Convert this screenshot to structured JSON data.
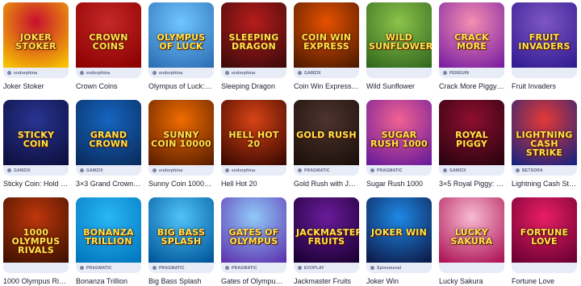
{
  "games": [
    {
      "caption": "Joker Stoker",
      "art": "JOKER STOKER",
      "bg": [
        "#c8102e",
        "#f7c400"
      ],
      "provider": "endorphina"
    },
    {
      "caption": "Crown Coins",
      "art": "CROWN COINS",
      "bg": [
        "#c62828",
        "#8b0000"
      ],
      "provider": "endorphina"
    },
    {
      "caption": "Olympus of Luck: H...",
      "art": "OLYMPUS OF LUCK",
      "bg": [
        "#6ec6ff",
        "#2e6fb5"
      ],
      "provider": "endorphina"
    },
    {
      "caption": "Sleeping Dragon",
      "art": "SLEEPING DRAGON",
      "bg": [
        "#b71c1c",
        "#3e0a0a"
      ],
      "provider": "endorphina"
    },
    {
      "caption": "Coin Win Express: H...",
      "art": "COIN WIN EXPRESS",
      "bg": [
        "#e65100",
        "#4e1a00"
      ],
      "provider": "GAMZIX"
    },
    {
      "caption": "Wild Sunflower",
      "art": "WILD SUNFLOWER",
      "bg": [
        "#8bc34a",
        "#33691e"
      ],
      "provider": ""
    },
    {
      "caption": "Crack More Piggy B...",
      "art": "CRACK MORE",
      "bg": [
        "#f48fb1",
        "#7b1fa2"
      ],
      "provider": "PENGUIN"
    },
    {
      "caption": "Fruit Invaders",
      "art": "FRUIT INVADERS",
      "bg": [
        "#7e57c2",
        "#311b92"
      ],
      "provider": ""
    },
    {
      "caption": "Sticky Coin: Hold th...",
      "art": "STICKY COIN",
      "bg": [
        "#283593",
        "#0d0f3d"
      ],
      "provider": "GAMZIX"
    },
    {
      "caption": "3×3 Grand Crown: H...",
      "art": "GRAND CROWN",
      "bg": [
        "#1565c0",
        "#0a2c5e"
      ],
      "provider": "GAMZIX"
    },
    {
      "caption": "Sunny Coin 10000: ...",
      "art": "SUNNY COIN 10000",
      "bg": [
        "#ef6c00",
        "#5d1f00"
      ],
      "provider": "endorphina"
    },
    {
      "caption": "Hell Hot 20",
      "art": "HELL HOT 20",
      "bg": [
        "#d84315",
        "#3b0900"
      ],
      "provider": "endorphina"
    },
    {
      "caption": "Gold Rush with John...",
      "art": "GOLD RUSH",
      "bg": [
        "#4e342e",
        "#1b0f0a"
      ],
      "provider": "PRAGMATIC"
    },
    {
      "caption": "Sugar Rush 1000",
      "art": "SUGAR RUSH 1000",
      "bg": [
        "#f06292",
        "#6a1b9a"
      ],
      "provider": "PRAGMATIC"
    },
    {
      "caption": "3×5 Royal Piggy: Ho...",
      "art": "ROYAL PIGGY",
      "bg": [
        "#8e0f2f",
        "#2a0310"
      ],
      "provider": "GAMZIX"
    },
    {
      "caption": "Lightning Cash Strik...",
      "art": "LIGHTNING CASH STRIKE",
      "bg": [
        "#e53935",
        "#1a237e"
      ],
      "provider": "BETSORA"
    },
    {
      "caption": "1000 Olympus Rivals",
      "art": "1000 OLYMPUS RIVALS",
      "bg": [
        "#bf360c",
        "#3e1200"
      ],
      "provider": ""
    },
    {
      "caption": "Bonanza Trillion",
      "art": "BONANZA TRILLION",
      "bg": [
        "#29b6f6",
        "#0277bd"
      ],
      "provider": "PRAGMATIC"
    },
    {
      "caption": "Big Bass Splash",
      "art": "BIG BASS SPLASH",
      "bg": [
        "#4fc3f7",
        "#01579b"
      ],
      "provider": "PRAGMATIC"
    },
    {
      "caption": "Gates of Olympus S...",
      "art": "GATES OF OLYMPUS",
      "bg": [
        "#90caf9",
        "#5e35b1"
      ],
      "provider": "PRAGMATIC"
    },
    {
      "caption": "Jackmaster Fruits",
      "art": "JACKMASTER FRUITS",
      "bg": [
        "#6a1b9a",
        "#1a0033"
      ],
      "provider": "EVOPLAY"
    },
    {
      "caption": "Joker Win",
      "art": "JOKER WIN",
      "bg": [
        "#1e88e5",
        "#0d1b4a"
      ],
      "provider": "Spinomenal"
    },
    {
      "caption": "Lucky Sakura",
      "art": "LUCKY SAKURA",
      "bg": [
        "#f8bbd0",
        "#ad1457"
      ],
      "provider": ""
    },
    {
      "caption": "Fortune Love",
      "art": "FORTUNE LOVE",
      "bg": [
        "#e91e63",
        "#6a0033"
      ],
      "provider": ""
    }
  ]
}
